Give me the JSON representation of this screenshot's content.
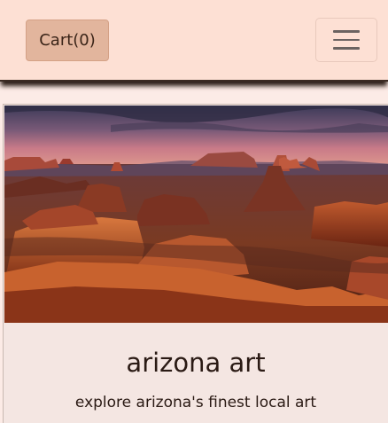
{
  "navbar": {
    "cart_label": "Cart(0)",
    "toggler_icon": "hamburger-menu-icon"
  },
  "card": {
    "image_alt": "arizona art",
    "title": "arizona art",
    "text": "explore arizona's finest local art"
  },
  "colors": {
    "navbar_bg": "#fde0d4",
    "cart_button_bg": "#e2b59d",
    "card_bg": "#f4e6e2",
    "text": "#2a1a14"
  }
}
